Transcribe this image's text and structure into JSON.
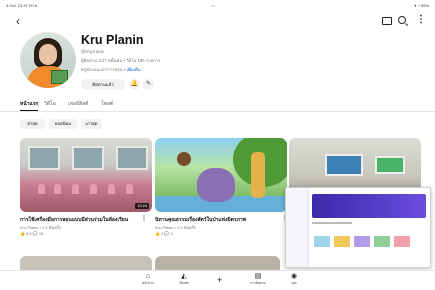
{
  "status_bar": {
    "left": "4 Oct. 21:37 Fri 6",
    "center": "•••",
    "right": "▾ ◔ 85%"
  },
  "channel": {
    "name": "Kru Planin",
    "handle": "@krupl anin",
    "stats": "ผู้ติดตาม 3.27 หมื่นคน • วิดีโอ 185 รายการ",
    "description": "ครูช่องแนะนำการสอน • ",
    "description_link": "เพิ่มเติม",
    "subscribe_label": "ติดตามแล้ว"
  },
  "tabs": [
    "หน้าแรก",
    "วิดีโอ",
    "เพลย์ลิสต์",
    "โพสต์"
  ],
  "active_tab": 0,
  "chips": [
    "ล่าสุด",
    "ยอดนิยม",
    "เก่าสุด"
  ],
  "videos": [
    {
      "title": "การใช้เครื่องมือการสอนแบบมีส่วนร่วมในห้องเรียน",
      "channel": "Kru Planin • 1.2 พันครั้ง",
      "stats": "👍 8.4   💬 16",
      "duration": "10:24"
    },
    {
      "title": "นิทานคุณธรรมเรื่องสัตว์ในป่าแห่งมิตรภาพ",
      "channel": "Kru Planin • 2.4 พันครั้ง",
      "stats": "👍 4   💬 5",
      "duration": ""
    },
    {
      "title": "",
      "channel": "",
      "stats": "",
      "duration": ""
    }
  ],
  "bottom_nav": [
    {
      "icon": "home-icon",
      "glyph": "⌂",
      "label": "หน้าแรก"
    },
    {
      "icon": "shorts-icon",
      "glyph": "◭",
      "label": "Shorts"
    },
    {
      "icon": "create-icon",
      "glyph": "+",
      "label": ""
    },
    {
      "icon": "subscriptions-icon",
      "glyph": "▤",
      "label": "การติดตาม"
    },
    {
      "icon": "you-icon",
      "glyph": "◉",
      "label": "คุณ"
    }
  ]
}
